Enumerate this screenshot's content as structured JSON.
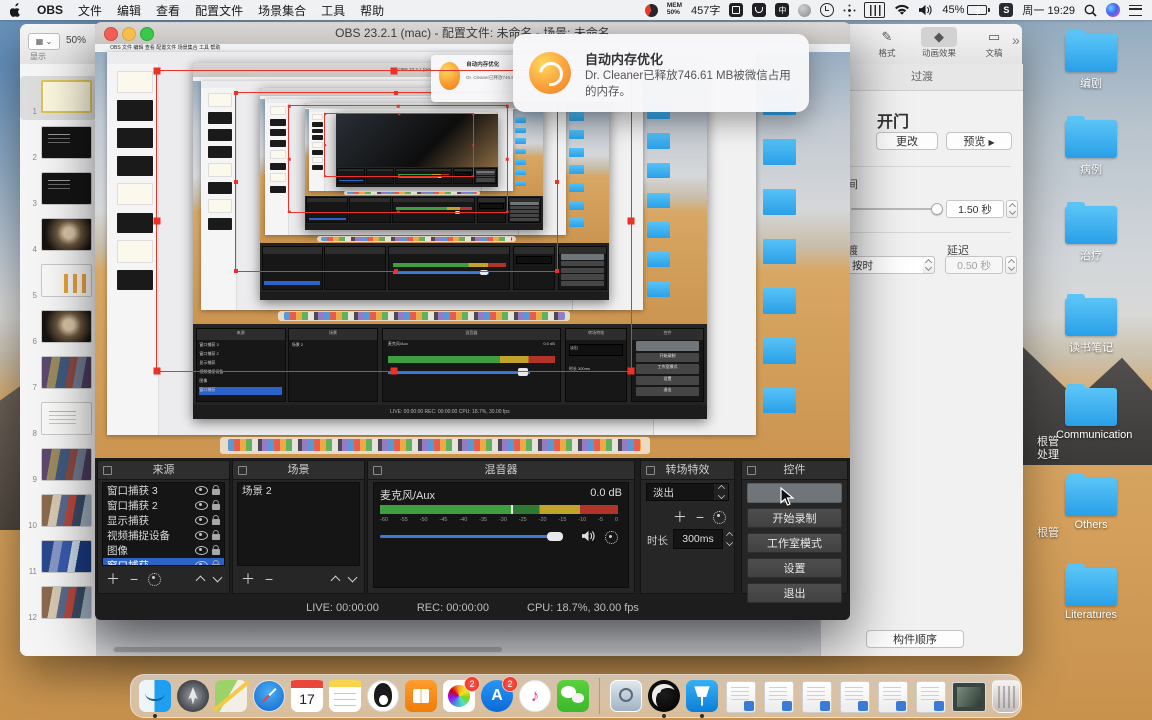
{
  "colors": {
    "selection_blue": "#2b63c9",
    "red_selection": "#ec3128",
    "folder_blue": "#3fb3f2"
  },
  "menu_bar": {
    "app_name": "OBS",
    "items": [
      "文件",
      "编辑",
      "查看",
      "配置文件",
      "场景集合",
      "工具",
      "帮助"
    ],
    "status_right": {
      "mem_line1": "MEM",
      "mem_line2": "50%",
      "word_count": "457字",
      "input_glyph": "中",
      "battery_percent": "45%",
      "proxy_label": "S",
      "clock": "周一 19:29"
    }
  },
  "notification": {
    "title": "自动内存优化",
    "body": "Dr. Cleaner已释放746.61 MB被微信占用的内存。"
  },
  "obs": {
    "window_title": "OBS 23.2.1 (mac) - 配置文件: 未命名 - 场景: 未命名",
    "menu_line": "OBS   文件   编辑   查看   配置文件   场景集合   工具   帮助",
    "sources": {
      "title": "来源",
      "items": [
        "窗口捕获 3",
        "窗口捕获 2",
        "显示捕获",
        "视频捕捉设备",
        "图像",
        "窗口捕获"
      ],
      "selected_index": 5
    },
    "scenes": {
      "title": "场景",
      "items": [
        "场景 2"
      ]
    },
    "mixer": {
      "title": "混音器",
      "channel": "麦克风/Aux",
      "level_db": "0.0 dB",
      "ticks": [
        "-60",
        "-55",
        "-50",
        "-45",
        "-40",
        "-35",
        "-30",
        "-25",
        "-20",
        "-15",
        "-10",
        "-5",
        "0"
      ]
    },
    "transitions": {
      "title": "转场特效",
      "selected": "淡出",
      "duration_label": "时长",
      "duration_value": "300ms"
    },
    "controls": {
      "title": "控件",
      "hover_button_label": "",
      "buttons": [
        "开始录制",
        "工作室模式",
        "设置",
        "退出"
      ]
    },
    "status_bar": {
      "live": "LIVE: 00:00:00",
      "rec": "REC: 00:00:00",
      "cpu": "CPU: 18.7%, 30.00 fps"
    }
  },
  "keynote": {
    "zoom_level": "50%",
    "view_label": "显示",
    "toolbar": [
      {
        "label": "格式",
        "selected": false
      },
      {
        "label": "动画效果",
        "selected": true
      },
      {
        "label": "文稿",
        "selected": false
      }
    ],
    "more_glyph": "»",
    "inspector": {
      "tab": "过渡",
      "effect_name": "开门",
      "change_button": "更改",
      "preview_button": "预览",
      "duration_label_partial": "间",
      "duration_value": "1.50 秒",
      "start_label_partial": "渡",
      "start_value": "按时",
      "delay_label": "延迟",
      "delay_value": "0.50 秒",
      "build_order_button": "构件顺序"
    },
    "slides": [
      {
        "num": "1",
        "style": "sel"
      },
      {
        "num": "2",
        "style": "dark"
      },
      {
        "num": "3",
        "style": "dark"
      },
      {
        "num": "4",
        "style": "photo"
      },
      {
        "num": "5",
        "style": "chart"
      },
      {
        "num": "6",
        "style": "photo"
      },
      {
        "num": "7",
        "style": "collage"
      },
      {
        "num": "8",
        "style": "text"
      },
      {
        "num": "9",
        "style": "collage"
      },
      {
        "num": "10",
        "style": "collage2"
      },
      {
        "num": "11",
        "style": "collageblue"
      },
      {
        "num": "12",
        "style": "collage2"
      }
    ]
  },
  "desktop": {
    "folders_right": [
      "编剧",
      "病例",
      "治疗",
      "读书笔记",
      "Communication",
      "Others",
      "Literatures"
    ],
    "folder_labels_partial": [
      "根管",
      "处理",
      "根管"
    ]
  },
  "dock": {
    "items": [
      {
        "name": "finder",
        "running": true
      },
      {
        "name": "launchpad"
      },
      {
        "name": "maps"
      },
      {
        "name": "safari"
      },
      {
        "name": "calendar",
        "day": "17"
      },
      {
        "name": "notes"
      },
      {
        "name": "qq"
      },
      {
        "name": "books"
      },
      {
        "name": "photos",
        "badge": "2"
      },
      {
        "name": "app-store",
        "badge": "2"
      },
      {
        "name": "itunes"
      },
      {
        "name": "wechat"
      },
      {
        "name": "separator"
      },
      {
        "name": "screenshot-viewer"
      },
      {
        "name": "obs",
        "running": true
      },
      {
        "name": "keynote",
        "running": true
      },
      {
        "name": "minimized-doc-1"
      },
      {
        "name": "minimized-doc-2"
      },
      {
        "name": "minimized-doc-3"
      },
      {
        "name": "minimized-doc-4"
      },
      {
        "name": "minimized-doc-5"
      },
      {
        "name": "minimized-doc-6"
      },
      {
        "name": "minimized-window"
      },
      {
        "name": "trash"
      }
    ]
  }
}
